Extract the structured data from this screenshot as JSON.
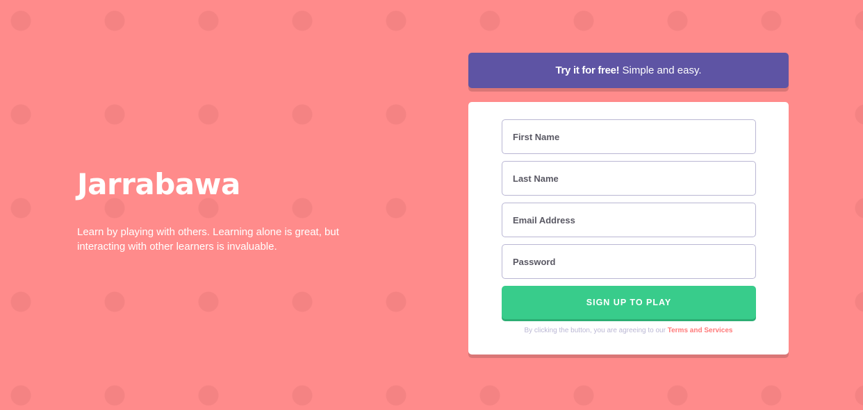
{
  "hero": {
    "title": "Jarrabawa",
    "description": "Learn by playing with others. Learning alone is great, but interacting with other learners is invaluable."
  },
  "promo": {
    "strong": "Try it for free!",
    "text": " Simple and easy."
  },
  "form": {
    "first_name_placeholder": "First Name",
    "last_name_placeholder": "Last Name",
    "email_placeholder": "Email Address",
    "password_placeholder": "Password",
    "submit_label": "SIGN UP TO PLAY",
    "terms_text": "By clicking the button, you are agreeing to our ",
    "terms_link": "Terms and Services"
  },
  "colors": {
    "background": "#ff8b8b",
    "promo": "#5e54a4",
    "submit": "#38cc8b",
    "link": "#ff7a7a"
  }
}
